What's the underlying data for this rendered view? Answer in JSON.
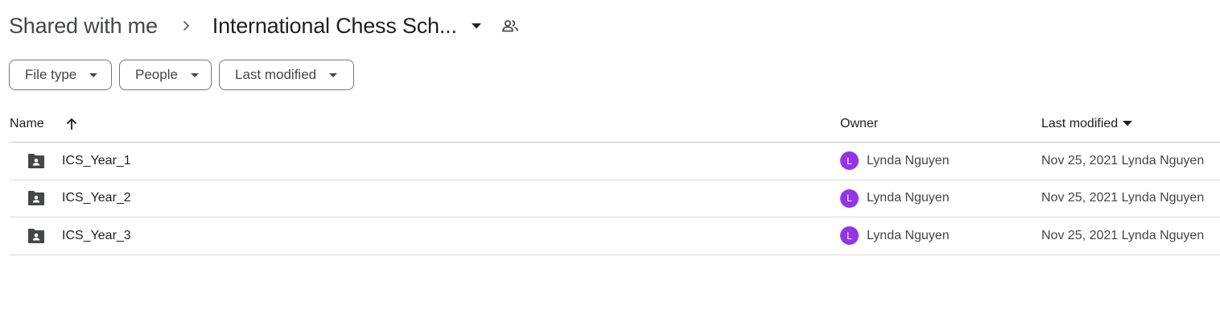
{
  "breadcrumb": {
    "root": "Shared with me",
    "current": "International Chess Sch..."
  },
  "filters": [
    {
      "label": "File type"
    },
    {
      "label": "People"
    },
    {
      "label": "Last modified"
    }
  ],
  "table": {
    "columns": {
      "name": "Name",
      "owner": "Owner",
      "last_modified": "Last modified"
    },
    "rows": [
      {
        "name": "ICS_Year_1",
        "owner": "Lynda Nguyen",
        "owner_initial": "L",
        "last_modified": "Nov 25, 2021 Lynda Nguyen"
      },
      {
        "name": "ICS_Year_2",
        "owner": "Lynda Nguyen",
        "owner_initial": "L",
        "last_modified": "Nov 25, 2021 Lynda Nguyen"
      },
      {
        "name": "ICS_Year_3",
        "owner": "Lynda Nguyen",
        "owner_initial": "L",
        "last_modified": "Nov 25, 2021 Lynda Nguyen"
      }
    ]
  },
  "icons": {
    "breadcrumb_separator": "chevron-right-icon",
    "breadcrumb_menu": "caret-down-icon",
    "shared": "people-icon",
    "sort": "arrow-up-icon",
    "folder": "shared-folder-icon"
  },
  "colors": {
    "avatar": "#9334e6",
    "folder": "#444746",
    "border": "#747775"
  }
}
